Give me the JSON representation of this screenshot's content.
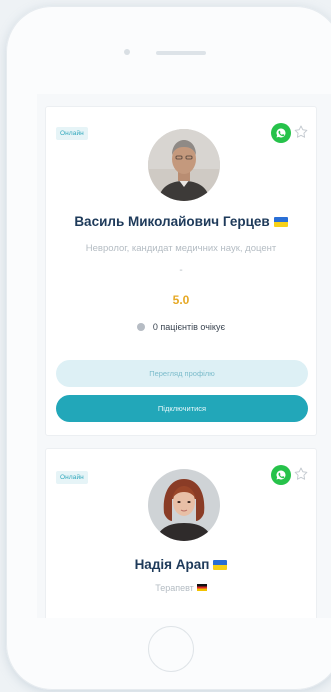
{
  "colors": {
    "accent": "#22a7b9",
    "name": "#1e3a5a",
    "rating": "#e6a823",
    "whatsapp": "#26c24a"
  },
  "doctors": [
    {
      "status_badge": "Онлайн",
      "name": "Василь Миколайович Герцев",
      "flag": "ukraine-flag",
      "specialty": "Невролог, кандидат медичних наук, доцент",
      "placeholder_dash": "-",
      "rating": "5.0",
      "queue_text": "0 пацієнтів очікує",
      "view_profile_label": "Перегляд профілю",
      "connect_label": "Підключитися"
    },
    {
      "status_badge": "Онлайн",
      "name": "Надія Арап",
      "flag": "ukraine-flag",
      "specialty": "Терапевт",
      "specialty_flag": "germany-flag"
    }
  ],
  "icons": {
    "messenger": "whatsapp-icon",
    "favorite": "star-outline-icon"
  }
}
